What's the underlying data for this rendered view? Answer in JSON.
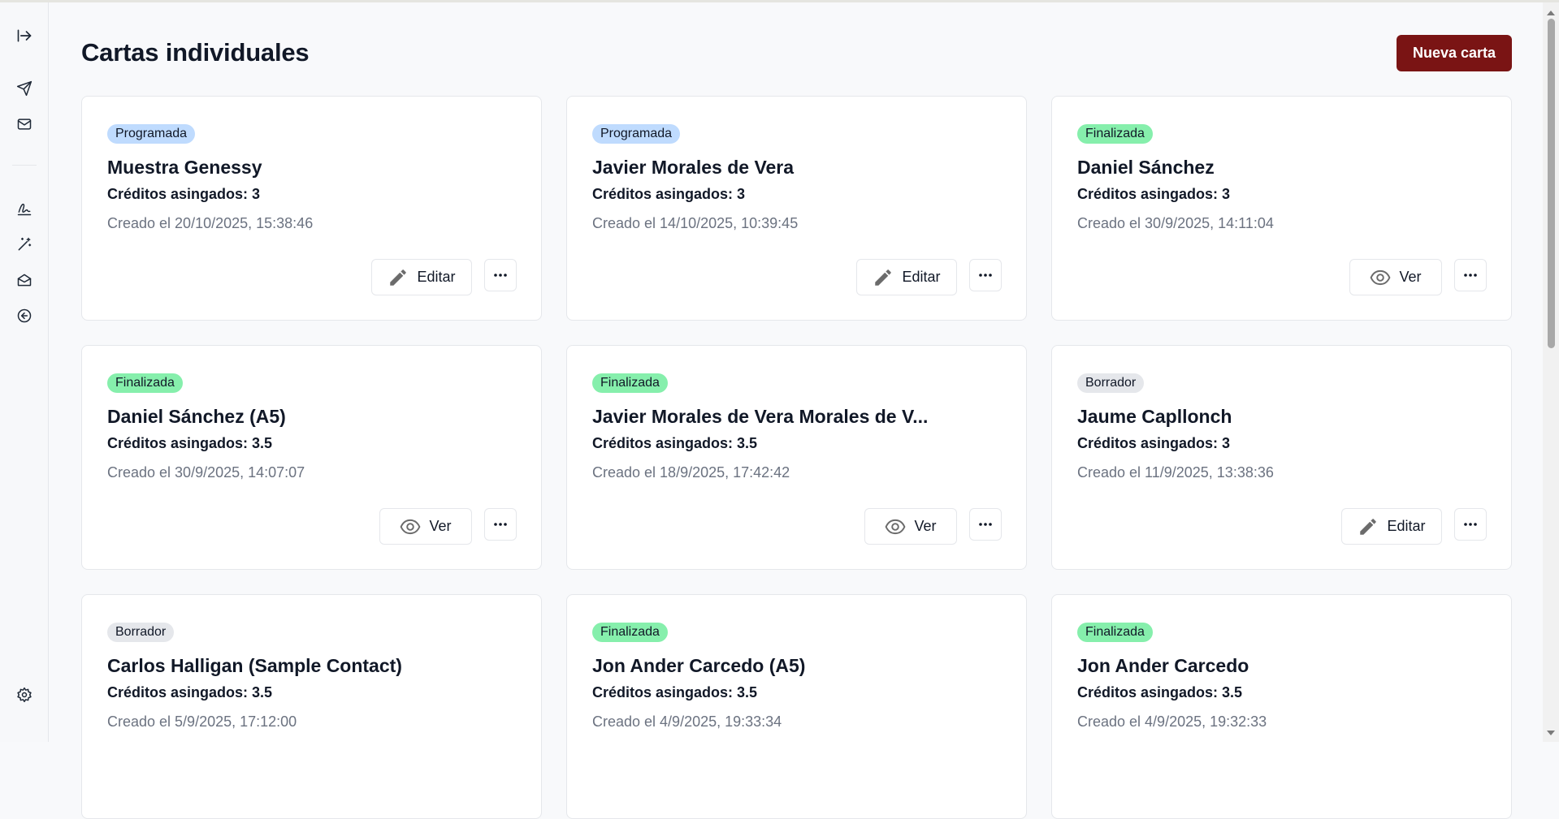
{
  "sidebar": {
    "icons": [
      "expand-sidebar-icon",
      "send-icon",
      "mail-icon",
      "signature-icon",
      "magic-wand-icon",
      "mail-open-icon",
      "back-arrow-circle-icon",
      "settings-icon"
    ]
  },
  "header": {
    "title": "Cartas individuales",
    "new_button_label": "Nueva carta"
  },
  "colors": {
    "accent": "#7a1414",
    "programada": "#bfdbfe",
    "finalizada": "#86efac",
    "borrador": "#e5e7eb"
  },
  "cards": [
    {
      "status": "Programada",
      "title": "Muestra Genessy",
      "credits": "Créditos asingados: 3",
      "created": "Creado el 20/10/2025, 15:38:46",
      "action": "Editar"
    },
    {
      "status": "Programada",
      "title": "Javier Morales de Vera",
      "credits": "Créditos asingados: 3",
      "created": "Creado el 14/10/2025, 10:39:45",
      "action": "Editar"
    },
    {
      "status": "Finalizada",
      "title": "Daniel Sánchez",
      "credits": "Créditos asingados: 3",
      "created": "Creado el 30/9/2025, 14:11:04",
      "action": "Ver"
    },
    {
      "status": "Finalizada",
      "title": "Daniel Sánchez (A5)",
      "credits": "Créditos asingados: 3.5",
      "created": "Creado el 30/9/2025, 14:07:07",
      "action": "Ver"
    },
    {
      "status": "Finalizada",
      "title": "Javier Morales de Vera Morales de V...",
      "credits": "Créditos asingados: 3.5",
      "created": "Creado el 18/9/2025, 17:42:42",
      "action": "Ver"
    },
    {
      "status": "Borrador",
      "title": "Jaume Capllonch",
      "credits": "Créditos asingados: 3",
      "created": "Creado el 11/9/2025, 13:38:36",
      "action": "Editar"
    },
    {
      "status": "Borrador",
      "title": "Carlos Halligan (Sample Contact)",
      "credits": "Créditos asingados: 3.5",
      "created": "Creado el 5/9/2025, 17:12:00",
      "action": ""
    },
    {
      "status": "Finalizada",
      "title": "Jon Ander Carcedo (A5)",
      "credits": "Créditos asingados: 3.5",
      "created": "Creado el 4/9/2025, 19:33:34",
      "action": ""
    },
    {
      "status": "Finalizada",
      "title": "Jon Ander Carcedo",
      "credits": "Créditos asingados: 3.5",
      "created": "Creado el 4/9/2025, 19:32:33",
      "action": ""
    }
  ]
}
